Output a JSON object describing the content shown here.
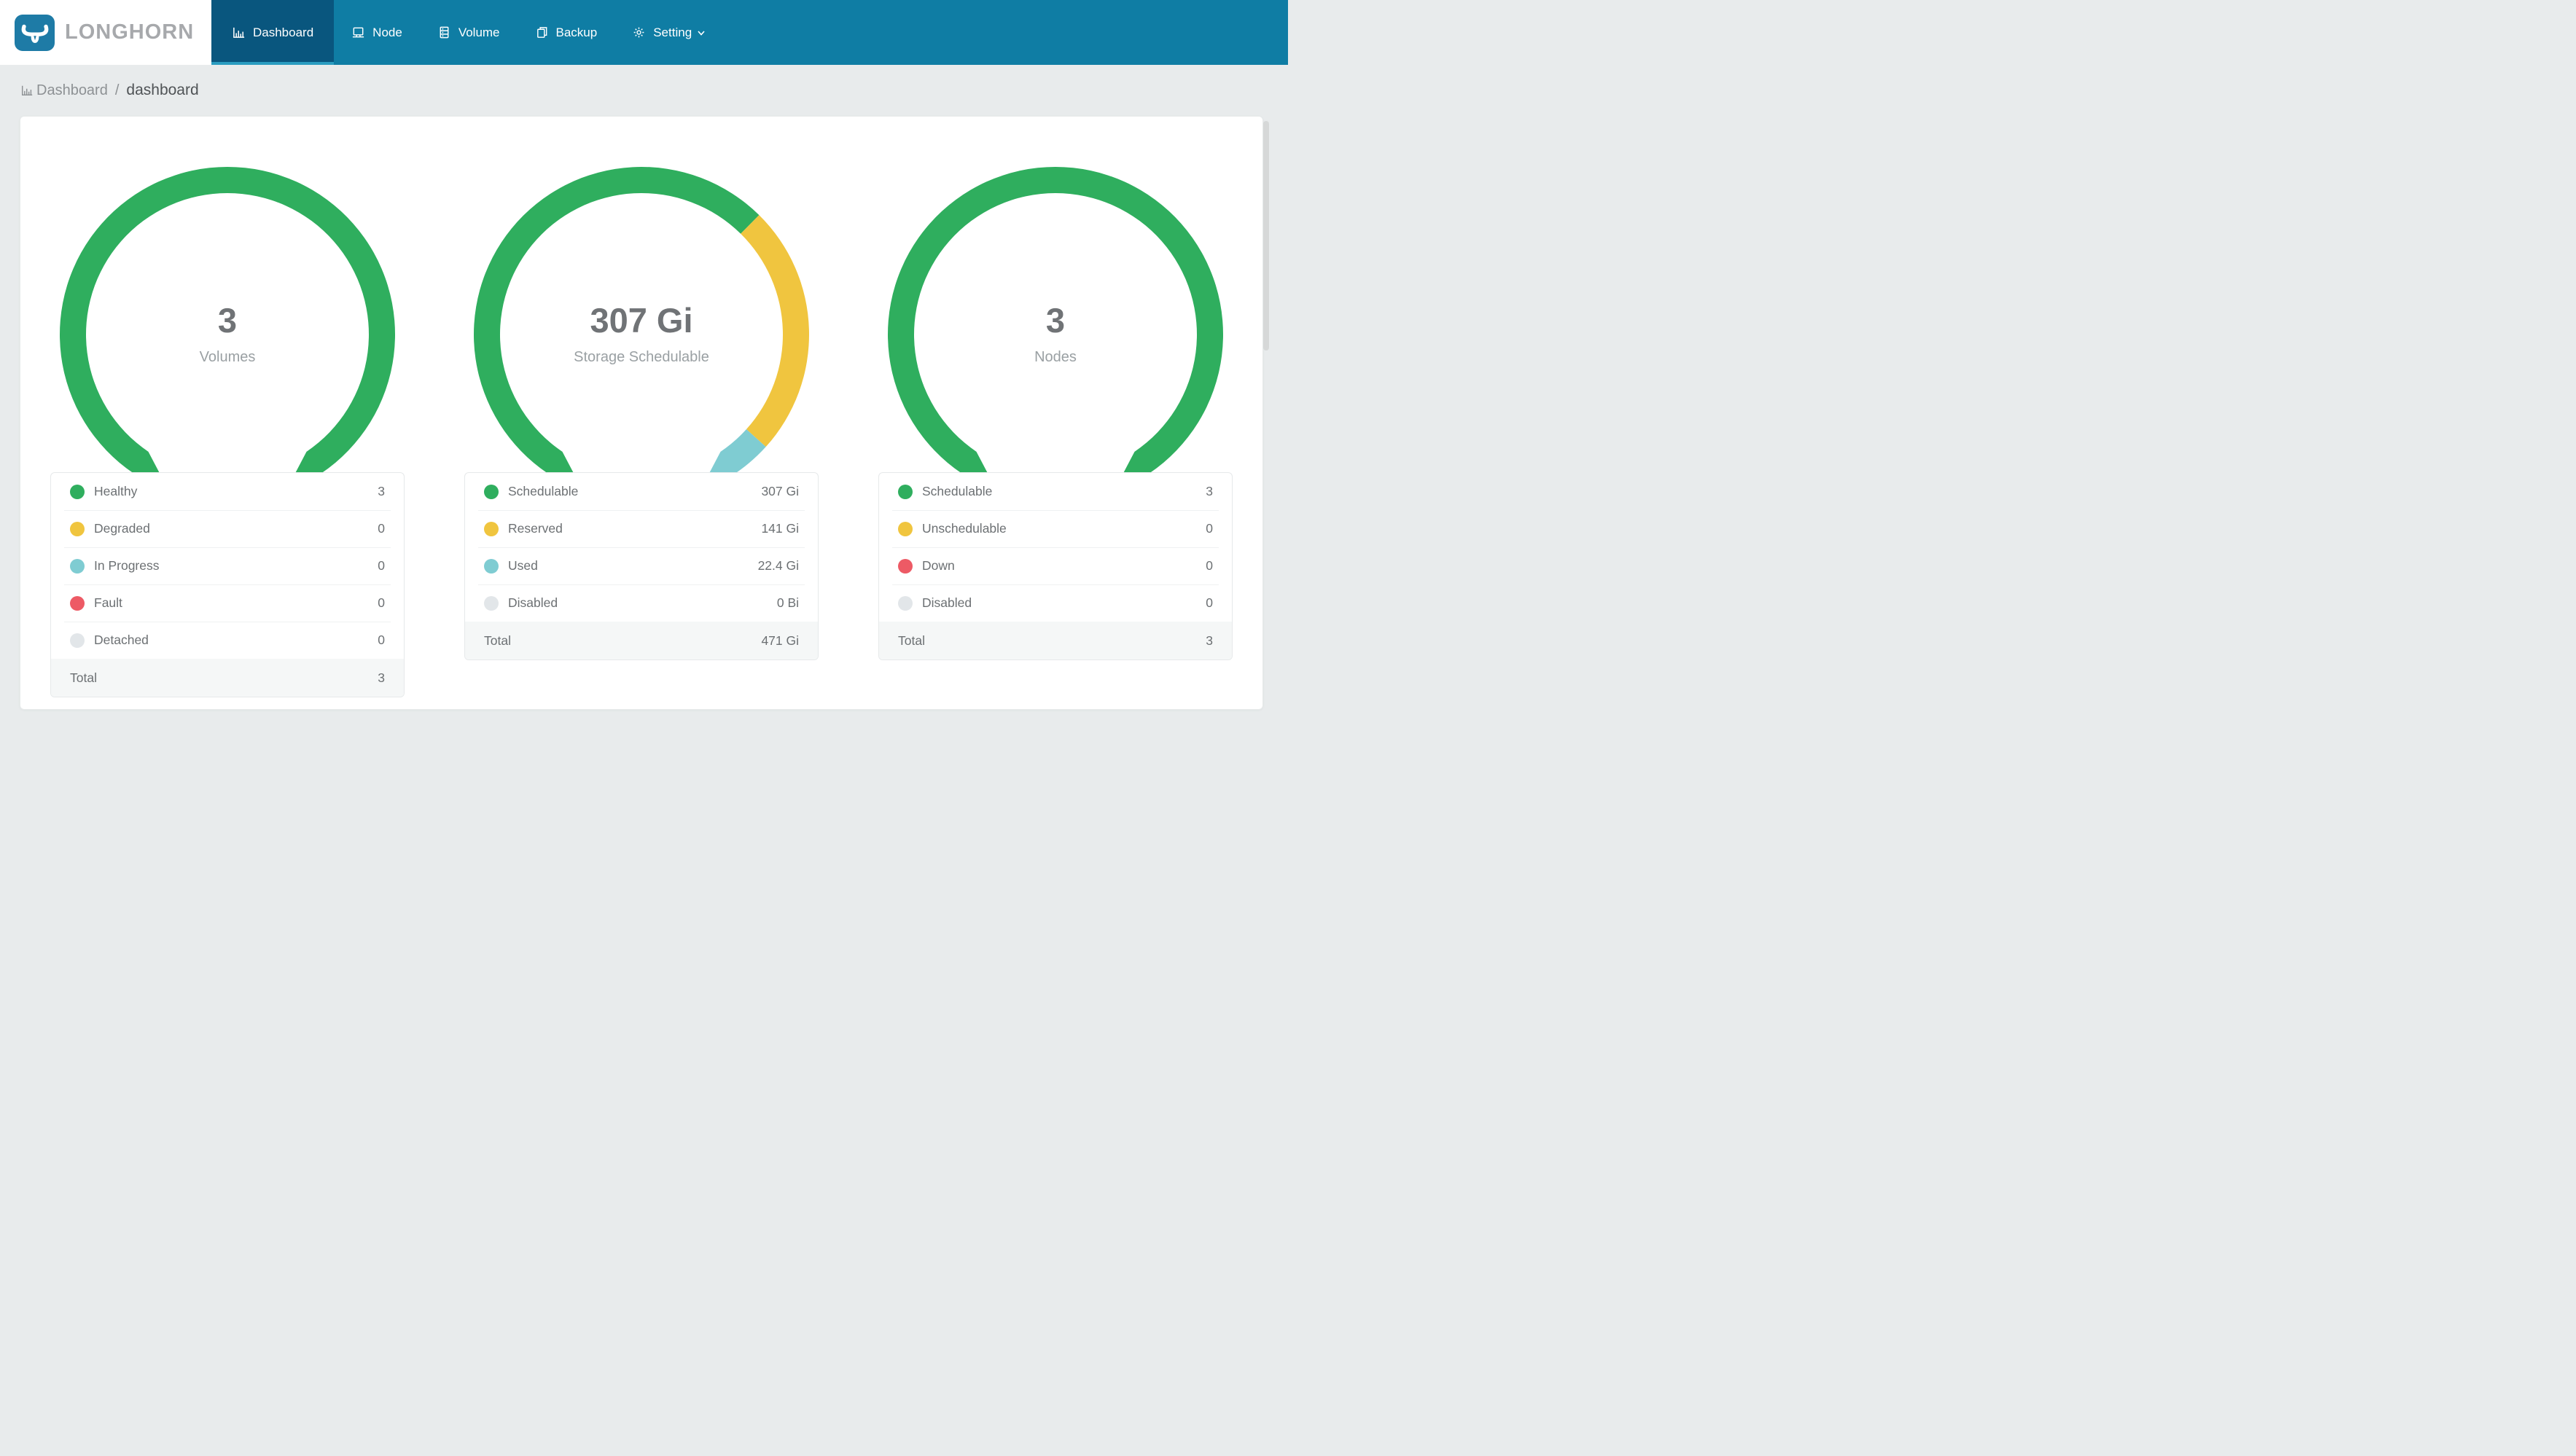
{
  "header": {
    "brand": "LONGHORN",
    "nav": [
      {
        "label": "Dashboard",
        "icon": "bar-chart-icon",
        "active": true
      },
      {
        "label": "Node",
        "icon": "laptop-icon",
        "active": false
      },
      {
        "label": "Volume",
        "icon": "server-icon",
        "active": false
      },
      {
        "label": "Backup",
        "icon": "file-copy-icon",
        "active": false
      },
      {
        "label": "Setting",
        "icon": "gear-icon",
        "active": false,
        "has_caret": true
      }
    ]
  },
  "breadcrumb": {
    "icon": "bar-chart-icon",
    "section": "Dashboard",
    "separator": "/",
    "page": "dashboard"
  },
  "colors": {
    "nav_bg": "#0f7da4",
    "nav_active_bg": "#09567e",
    "nav_active_underline": "#2a9cc0",
    "logo_blue": "#1e7ba6",
    "status_green": "#2fae5e",
    "status_yellow": "#f0c53f",
    "status_teal": "#7fccd2",
    "status_red": "#ed5a65",
    "status_gray": "#e2e6e9"
  },
  "chart_data": [
    {
      "type": "donut-gauge",
      "center_value": "3",
      "center_label": "Volumes",
      "categories": [
        "Healthy",
        "Degraded",
        "In Progress",
        "Fault",
        "Detached"
      ],
      "values": [
        3,
        0,
        0,
        0,
        0
      ],
      "value_labels": [
        "3",
        "0",
        "0",
        "0",
        "0"
      ],
      "colors": [
        "#2fae5e",
        "#f0c53f",
        "#7fccd2",
        "#ed5a65",
        "#e2e6e9"
      ],
      "total_label": "Total",
      "total_value": 3,
      "total_display": "3",
      "arc": {
        "gap_deg": 68,
        "start_bearing_deg": 214,
        "span_deg": 292
      }
    },
    {
      "type": "donut-gauge",
      "center_value": "307 Gi",
      "center_label": "Storage Schedulable",
      "categories": [
        "Schedulable",
        "Reserved",
        "Used",
        "Disabled"
      ],
      "values": [
        307,
        141,
        22.4,
        0
      ],
      "value_labels": [
        "307 Gi",
        "141 Gi",
        "22.4 Gi",
        "0 Bi"
      ],
      "colors": [
        "#2fae5e",
        "#f0c53f",
        "#7fccd2",
        "#e2e6e9"
      ],
      "total_label": "Total",
      "total_value": 471,
      "total_display": "471 Gi",
      "arc": {
        "gap_deg": 68,
        "start_bearing_deg": 214,
        "span_deg": 292
      }
    },
    {
      "type": "donut-gauge",
      "center_value": "3",
      "center_label": "Nodes",
      "categories": [
        "Schedulable",
        "Unschedulable",
        "Down",
        "Disabled"
      ],
      "values": [
        3,
        0,
        0,
        0
      ],
      "value_labels": [
        "3",
        "0",
        "0",
        "0"
      ],
      "colors": [
        "#2fae5e",
        "#f0c53f",
        "#ed5a65",
        "#e2e6e9"
      ],
      "total_label": "Total",
      "total_value": 3,
      "total_display": "3",
      "arc": {
        "gap_deg": 68,
        "start_bearing_deg": 214,
        "span_deg": 292
      }
    }
  ]
}
